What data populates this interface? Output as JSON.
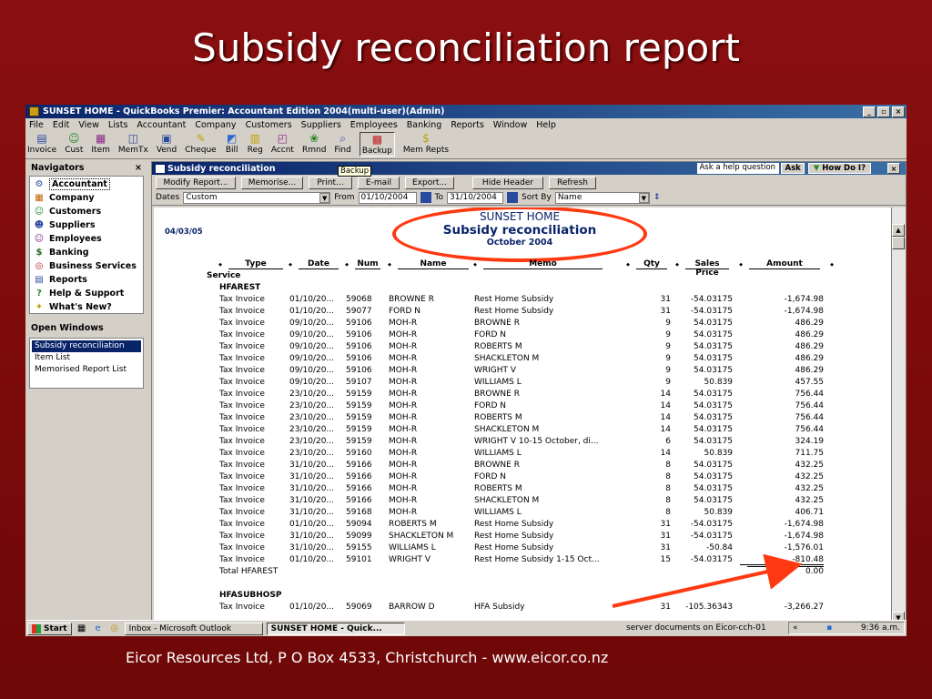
{
  "slide": {
    "title": "Subsidy reconciliation report",
    "footer": "Eicor Resources Ltd, P O Box 4533, Christchurch -  www.eicor.co.nz"
  },
  "app": {
    "title": "SUNSET HOME - QuickBooks Premier: Accountant Edition 2004(multi-user)(Admin)",
    "window_buttons": [
      "_",
      "▫",
      "×"
    ]
  },
  "menu": [
    "File",
    "Edit",
    "View",
    "Lists",
    "Accountant",
    "Company",
    "Customers",
    "Suppliers",
    "Employees",
    "Banking",
    "Reports",
    "Window",
    "Help"
  ],
  "toolbar": [
    {
      "label": "Invoice",
      "icon": "invoice-icon"
    },
    {
      "label": "Cust",
      "icon": "customer-icon"
    },
    {
      "label": "Item",
      "icon": "item-icon"
    },
    {
      "label": "MemTx",
      "icon": "memorized-tx-icon"
    },
    {
      "label": "Vend",
      "icon": "vendor-icon"
    },
    {
      "label": "Cheque",
      "icon": "cheque-icon"
    },
    {
      "label": "Bill",
      "icon": "bill-icon"
    },
    {
      "label": "Reg",
      "icon": "register-icon"
    },
    {
      "label": "Accnt",
      "icon": "account-icon"
    },
    {
      "label": "Rmnd",
      "icon": "reminder-icon"
    },
    {
      "label": "Find",
      "icon": "find-icon"
    },
    {
      "label": "Backup",
      "icon": "backup-icon"
    },
    {
      "label": "Mem Repts",
      "icon": "memorized-reports-icon"
    }
  ],
  "tooltip": "Backup",
  "navigators": {
    "heading": "Navigators",
    "close": "×",
    "items": [
      {
        "label": "Accountant"
      },
      {
        "label": "Company"
      },
      {
        "label": "Customers"
      },
      {
        "label": "Suppliers"
      },
      {
        "label": "Employees"
      },
      {
        "label": "Banking"
      },
      {
        "label": "Business Services"
      },
      {
        "label": "Reports"
      },
      {
        "label": "Help & Support"
      },
      {
        "label": "What's New?"
      }
    ]
  },
  "open_windows": {
    "heading": "Open Windows",
    "items": [
      "Subsidy reconciliation",
      "Item List",
      "Memorised Report List"
    ]
  },
  "report_window": {
    "title": "Subsidy reconciliation",
    "ask_placeholder": "Ask a help question",
    "ask_button": "Ask",
    "how_do_i": "How Do I?",
    "close": "×",
    "buttons": [
      "Modify Report...",
      "Memorise...",
      "Print...",
      "E-mail",
      "Export...",
      "Hide Header",
      "Refresh"
    ],
    "filters": {
      "dates_label": "Dates",
      "dates_value": "Custom",
      "from_label": "From",
      "from_value": "01/10/2004",
      "to_label": "To",
      "to_value": "31/10/2004",
      "sort_label": "Sort By",
      "sort_value": "Name"
    }
  },
  "report": {
    "run_date": "04/03/05",
    "company": "SUNSET HOME",
    "title": "Subsidy reconciliation",
    "period": "October 2004",
    "columns": [
      "Type",
      "Date",
      "Num",
      "Name",
      "Memo",
      "Qty",
      "Sales Price",
      "Amount"
    ],
    "rows": [
      {
        "kind": "section",
        "type": "Service"
      },
      {
        "kind": "section2",
        "type": "HFAREST"
      },
      {
        "type": "Tax Invoice",
        "date": "01/10/20...",
        "num": "59068",
        "name": "BROWNE R",
        "memo": "Rest Home Subsidy",
        "qty": "31",
        "price": "-54.03175",
        "amount": "-1,674.98"
      },
      {
        "type": "Tax Invoice",
        "date": "01/10/20...",
        "num": "59077",
        "name": "FORD N",
        "memo": "Rest Home Subsidy",
        "qty": "31",
        "price": "-54.03175",
        "amount": "-1,674.98"
      },
      {
        "type": "Tax Invoice",
        "date": "09/10/20...",
        "num": "59106",
        "name": "MOH-R",
        "memo": "BROWNE R",
        "qty": "9",
        "price": "54.03175",
        "amount": "486.29"
      },
      {
        "type": "Tax Invoice",
        "date": "09/10/20...",
        "num": "59106",
        "name": "MOH-R",
        "memo": "FORD N",
        "qty": "9",
        "price": "54.03175",
        "amount": "486.29"
      },
      {
        "type": "Tax Invoice",
        "date": "09/10/20...",
        "num": "59106",
        "name": "MOH-R",
        "memo": "ROBERTS M",
        "qty": "9",
        "price": "54.03175",
        "amount": "486.29"
      },
      {
        "type": "Tax Invoice",
        "date": "09/10/20...",
        "num": "59106",
        "name": "MOH-R",
        "memo": "SHACKLETON M",
        "qty": "9",
        "price": "54.03175",
        "amount": "486.29"
      },
      {
        "type": "Tax Invoice",
        "date": "09/10/20...",
        "num": "59106",
        "name": "MOH-R",
        "memo": "WRIGHT V",
        "qty": "9",
        "price": "54.03175",
        "amount": "486.29"
      },
      {
        "type": "Tax Invoice",
        "date": "09/10/20...",
        "num": "59107",
        "name": "MOH-R",
        "memo": "WILLIAMS L",
        "qty": "9",
        "price": "50.839",
        "amount": "457.55"
      },
      {
        "type": "Tax Invoice",
        "date": "23/10/20...",
        "num": "59159",
        "name": "MOH-R",
        "memo": "BROWNE R",
        "qty": "14",
        "price": "54.03175",
        "amount": "756.44"
      },
      {
        "type": "Tax Invoice",
        "date": "23/10/20...",
        "num": "59159",
        "name": "MOH-R",
        "memo": "FORD N",
        "qty": "14",
        "price": "54.03175",
        "amount": "756.44"
      },
      {
        "type": "Tax Invoice",
        "date": "23/10/20...",
        "num": "59159",
        "name": "MOH-R",
        "memo": "ROBERTS M",
        "qty": "14",
        "price": "54.03175",
        "amount": "756.44"
      },
      {
        "type": "Tax Invoice",
        "date": "23/10/20...",
        "num": "59159",
        "name": "MOH-R",
        "memo": "SHACKLETON M",
        "qty": "14",
        "price": "54.03175",
        "amount": "756.44"
      },
      {
        "type": "Tax Invoice",
        "date": "23/10/20...",
        "num": "59159",
        "name": "MOH-R",
        "memo": "WRIGHT V 10-15 October, di...",
        "qty": "6",
        "price": "54.03175",
        "amount": "324.19"
      },
      {
        "type": "Tax Invoice",
        "date": "23/10/20...",
        "num": "59160",
        "name": "MOH-R",
        "memo": "WILLIAMS L",
        "qty": "14",
        "price": "50.839",
        "amount": "711.75"
      },
      {
        "type": "Tax Invoice",
        "date": "31/10/20...",
        "num": "59166",
        "name": "MOH-R",
        "memo": "BROWNE R",
        "qty": "8",
        "price": "54.03175",
        "amount": "432.25"
      },
      {
        "type": "Tax Invoice",
        "date": "31/10/20...",
        "num": "59166",
        "name": "MOH-R",
        "memo": "FORD N",
        "qty": "8",
        "price": "54.03175",
        "amount": "432.25"
      },
      {
        "type": "Tax Invoice",
        "date": "31/10/20...",
        "num": "59166",
        "name": "MOH-R",
        "memo": "ROBERTS M",
        "qty": "8",
        "price": "54.03175",
        "amount": "432.25"
      },
      {
        "type": "Tax Invoice",
        "date": "31/10/20...",
        "num": "59166",
        "name": "MOH-R",
        "memo": "SHACKLETON M",
        "qty": "8",
        "price": "54.03175",
        "amount": "432.25"
      },
      {
        "type": "Tax Invoice",
        "date": "31/10/20...",
        "num": "59168",
        "name": "MOH-R",
        "memo": "WILLIAMS L",
        "qty": "8",
        "price": "50.839",
        "amount": "406.71"
      },
      {
        "type": "Tax Invoice",
        "date": "01/10/20...",
        "num": "59094",
        "name": "ROBERTS M",
        "memo": "Rest Home Subsidy",
        "qty": "31",
        "price": "-54.03175",
        "amount": "-1,674.98"
      },
      {
        "type": "Tax Invoice",
        "date": "31/10/20...",
        "num": "59099",
        "name": "SHACKLETON M",
        "memo": "Rest Home Subsidy",
        "qty": "31",
        "price": "-54.03175",
        "amount": "-1,674.98"
      },
      {
        "type": "Tax Invoice",
        "date": "31/10/20...",
        "num": "59155",
        "name": "WILLIAMS L",
        "memo": "Rest Home Subsidy",
        "qty": "31",
        "price": "-50.84",
        "amount": "-1,576.01"
      },
      {
        "type": "Tax Invoice",
        "date": "01/10/20...",
        "num": "59101",
        "name": "WRIGHT V",
        "memo": "Rest Home Subsidy 1-15 Oct...",
        "qty": "15",
        "price": "-54.03175",
        "amount": "-810.48"
      },
      {
        "kind": "total",
        "type": "Total HFAREST",
        "amount": "0.00"
      },
      {
        "kind": "blank"
      },
      {
        "kind": "section2",
        "type": "HFASUBHOSP"
      },
      {
        "type": "Tax Invoice",
        "date": "01/10/20...",
        "num": "59069",
        "name": "BARROW D",
        "memo": "HFA Subsidy",
        "qty": "31",
        "price": "-105.36343",
        "amount": "-3,266.27"
      }
    ]
  },
  "taskbar": {
    "start": "Start",
    "tasks": [
      "Inbox - Microsoft Outlook",
      "SUNSET HOME - Quick..."
    ],
    "tray_text": "server documents on Eicor-cch-01",
    "clock": "9:36 a.m."
  },
  "colors": {
    "slide_bg": "#7d0b0b",
    "titlebar": "#0a246a",
    "report_blue": "#0a246a",
    "highlight": "#ff3a12"
  }
}
